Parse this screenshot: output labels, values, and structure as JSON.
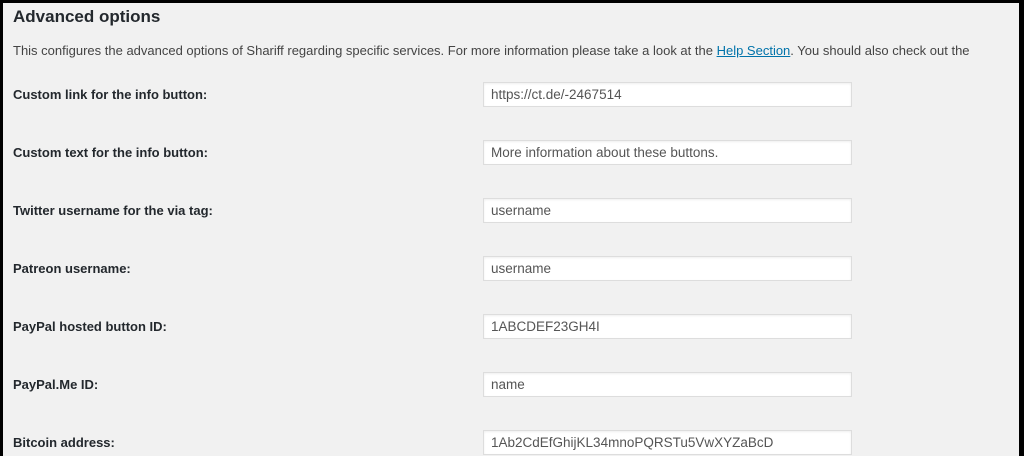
{
  "section": {
    "title": "Advanced options",
    "description_before_link": "This configures the advanced options of Shariff regarding specific services. For more information please take a look at the ",
    "help_link": "Help Section",
    "description_after_link": ". You should also check out the"
  },
  "fields": {
    "info_link": {
      "label": "Custom link for the info button:",
      "value": "https://ct.de/-2467514"
    },
    "info_text": {
      "label": "Custom text for the info button:",
      "value": "More information about these buttons."
    },
    "twitter": {
      "label": "Twitter username for the via tag:",
      "value": "username"
    },
    "patreon": {
      "label": "Patreon username:",
      "value": "username"
    },
    "paypal_button": {
      "label": "PayPal hosted button ID:",
      "value": "1ABCDEF23GH4I"
    },
    "paypalme": {
      "label": "PayPal.Me ID:",
      "value": "name"
    },
    "bitcoin": {
      "label": "Bitcoin address:",
      "value": "1Ab2CdEfGhijKL34mnoPQRSTu5VwXYZaBcD"
    }
  },
  "colors": {
    "link": "#0073aa",
    "background": "#f1f1f1",
    "frame_border": "#000000"
  }
}
